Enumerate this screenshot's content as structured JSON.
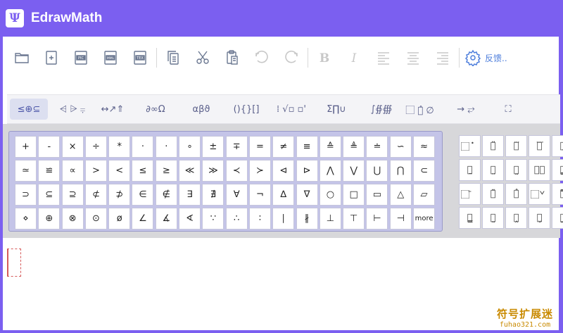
{
  "app": {
    "title": "EdrawMath",
    "logo_glyph": "Ψ",
    "brand_color": "#7b5ff0"
  },
  "toolbar": {
    "buttons": [
      {
        "name": "open-folder-icon"
      },
      {
        "name": "new-file-icon"
      },
      {
        "name": "export-pic-icon"
      },
      {
        "name": "export-mml-icon"
      },
      {
        "name": "export-tex-icon"
      },
      {
        "name": "copy-icon"
      },
      {
        "name": "cut-icon"
      },
      {
        "name": "paste-icon"
      },
      {
        "name": "undo-icon"
      },
      {
        "name": "redo-icon"
      },
      {
        "name": "bold-icon"
      },
      {
        "name": "italic-icon"
      },
      {
        "name": "align-left-icon"
      },
      {
        "name": "align-center-icon"
      },
      {
        "name": "align-right-icon"
      },
      {
        "name": "settings-icon"
      }
    ],
    "feedback_label": "反馈.."
  },
  "palette_tabs": [
    {
      "label": "≤⊕⊆",
      "active": true
    },
    {
      "label": "⩤ ⩥ ⩦",
      "active": false
    },
    {
      "label": "↔↗⇑",
      "active": false
    },
    {
      "label": "∂∞Ω",
      "active": false
    },
    {
      "label": "αβϑ",
      "active": false
    },
    {
      "label": "(){}[]",
      "active": false
    },
    {
      "label": "⁞ √▫ ▫'",
      "active": false
    },
    {
      "label": "Σ∏∪",
      "active": false
    },
    {
      "label": "∫∯∰",
      "active": false
    },
    {
      "label": "⃞ ⃞̂ ∅",
      "active": false
    },
    {
      "label": "→ ⥂",
      "active": false
    },
    {
      "label": "⛶",
      "active": false
    }
  ],
  "symbols": [
    "+",
    "-",
    "×",
    "÷",
    "*",
    "·",
    "·",
    "∘",
    "±",
    "∓",
    "=",
    "≠",
    "≡",
    "≙",
    "≜",
    "≐",
    "∽",
    "≈",
    "≃",
    "≌",
    "∝",
    ">",
    "<",
    "≤",
    "≥",
    "≪",
    "≫",
    "≺",
    "≻",
    "⊲",
    "⊳",
    "⋀",
    "⋁",
    "⋃",
    "⋂",
    "⊂",
    "⊃",
    "⊆",
    "⊇",
    "⊄",
    "⊅",
    "∈",
    "∉",
    "∃",
    "∄",
    "∀",
    "¬",
    "∆",
    "∇",
    "○",
    "□",
    "▭",
    "△",
    "▱",
    "⋄",
    "⊕",
    "⊗",
    "⊙",
    "ø",
    "∠",
    "∡",
    "∢",
    "∵",
    "∴",
    "∶",
    "∣",
    "∦",
    "⊥",
    "⊤",
    "⊢",
    "⊣",
    "more"
  ],
  "accents": [
    "⃞̇",
    "⃞̈",
    "⃞⃛",
    "⃞⃜",
    "⃞̣",
    "⃞̱",
    "⃞̤",
    "⃞̰",
    "⃞⃨",
    "⃞̳",
    "⃞̄",
    "⃞̃",
    "⃞̂",
    "⃞̌",
    "⃞̿",
    "⃞̳",
    "⃞̰",
    "⃞̭",
    "⃞̬",
    "⃞̲"
  ],
  "watermark": {
    "cn": "符号扩展迷",
    "url": "fuhao321.com"
  }
}
